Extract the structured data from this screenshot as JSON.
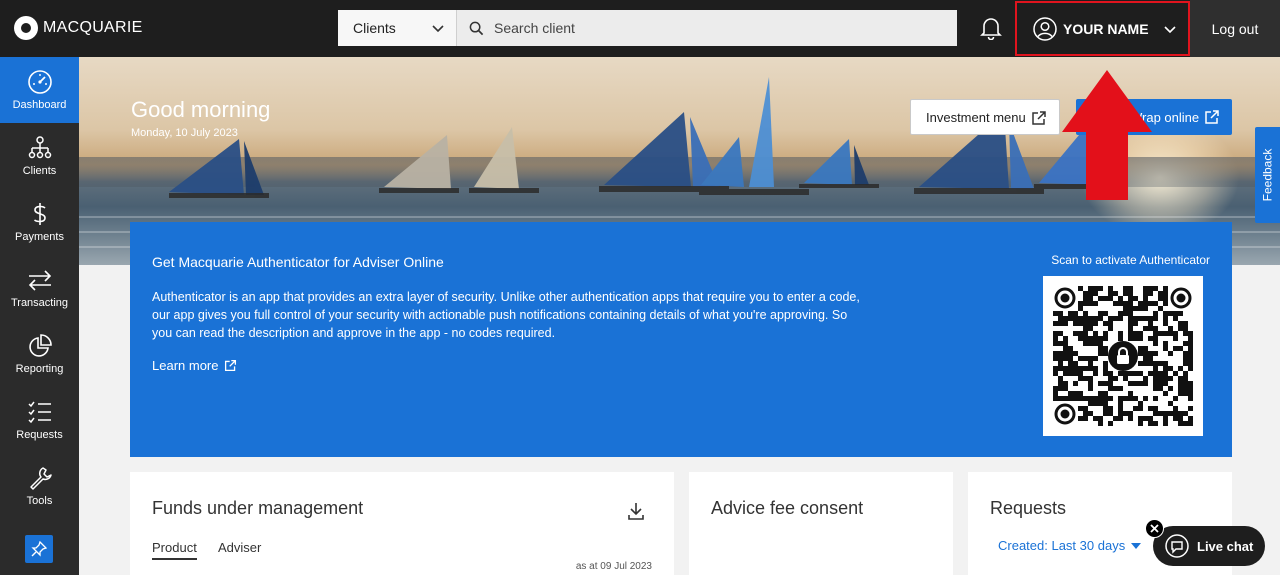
{
  "brand": {
    "name": "MACQUARIE"
  },
  "header": {
    "search_scope": "Clients",
    "search_placeholder": "Search client",
    "user_name": "YOUR NAME",
    "logout_label": "Log out"
  },
  "sidebar": {
    "items": [
      {
        "label": "Dashboard",
        "icon": "dashboard-icon"
      },
      {
        "label": "Clients",
        "icon": "clients-icon"
      },
      {
        "label": "Payments",
        "icon": "dollar-icon"
      },
      {
        "label": "Transacting",
        "icon": "transfer-icon"
      },
      {
        "label": "Reporting",
        "icon": "pie-chart-icon"
      },
      {
        "label": "Requests",
        "icon": "checklist-icon"
      },
      {
        "label": "Tools",
        "icon": "wrench-icon"
      }
    ]
  },
  "hero": {
    "greeting": "Good morning",
    "date": "Monday, 10 July 2023",
    "investment_menu_label": "Investment menu",
    "wrap_online_label": "Wrap online"
  },
  "feedback_label": "Feedback",
  "authenticator": {
    "title": "Get Macquarie Authenticator for Adviser Online",
    "body": "Authenticator is an app that provides an extra layer of security. Unlike other authentication apps that require you to enter a code, our app gives you full control of your security with actionable push notifications containing details of what you're approving. So you can read the description and approve in the app - no codes required.",
    "learn_more": "Learn more",
    "scan_label": "Scan to activate Authenticator"
  },
  "cards": {
    "funds": {
      "title": "Funds under management",
      "tabs": [
        "Product",
        "Adviser"
      ],
      "as_at": "as at 09 Jul 2023"
    },
    "fee": {
      "title": "Advice fee consent"
    },
    "requests": {
      "title": "Requests",
      "filter": "Created: Last 30 days"
    }
  },
  "live_chat_label": "Live chat",
  "colors": {
    "accent": "#1a72d6",
    "topbar": "#1e1e1e",
    "highlight": "#e0141e"
  }
}
